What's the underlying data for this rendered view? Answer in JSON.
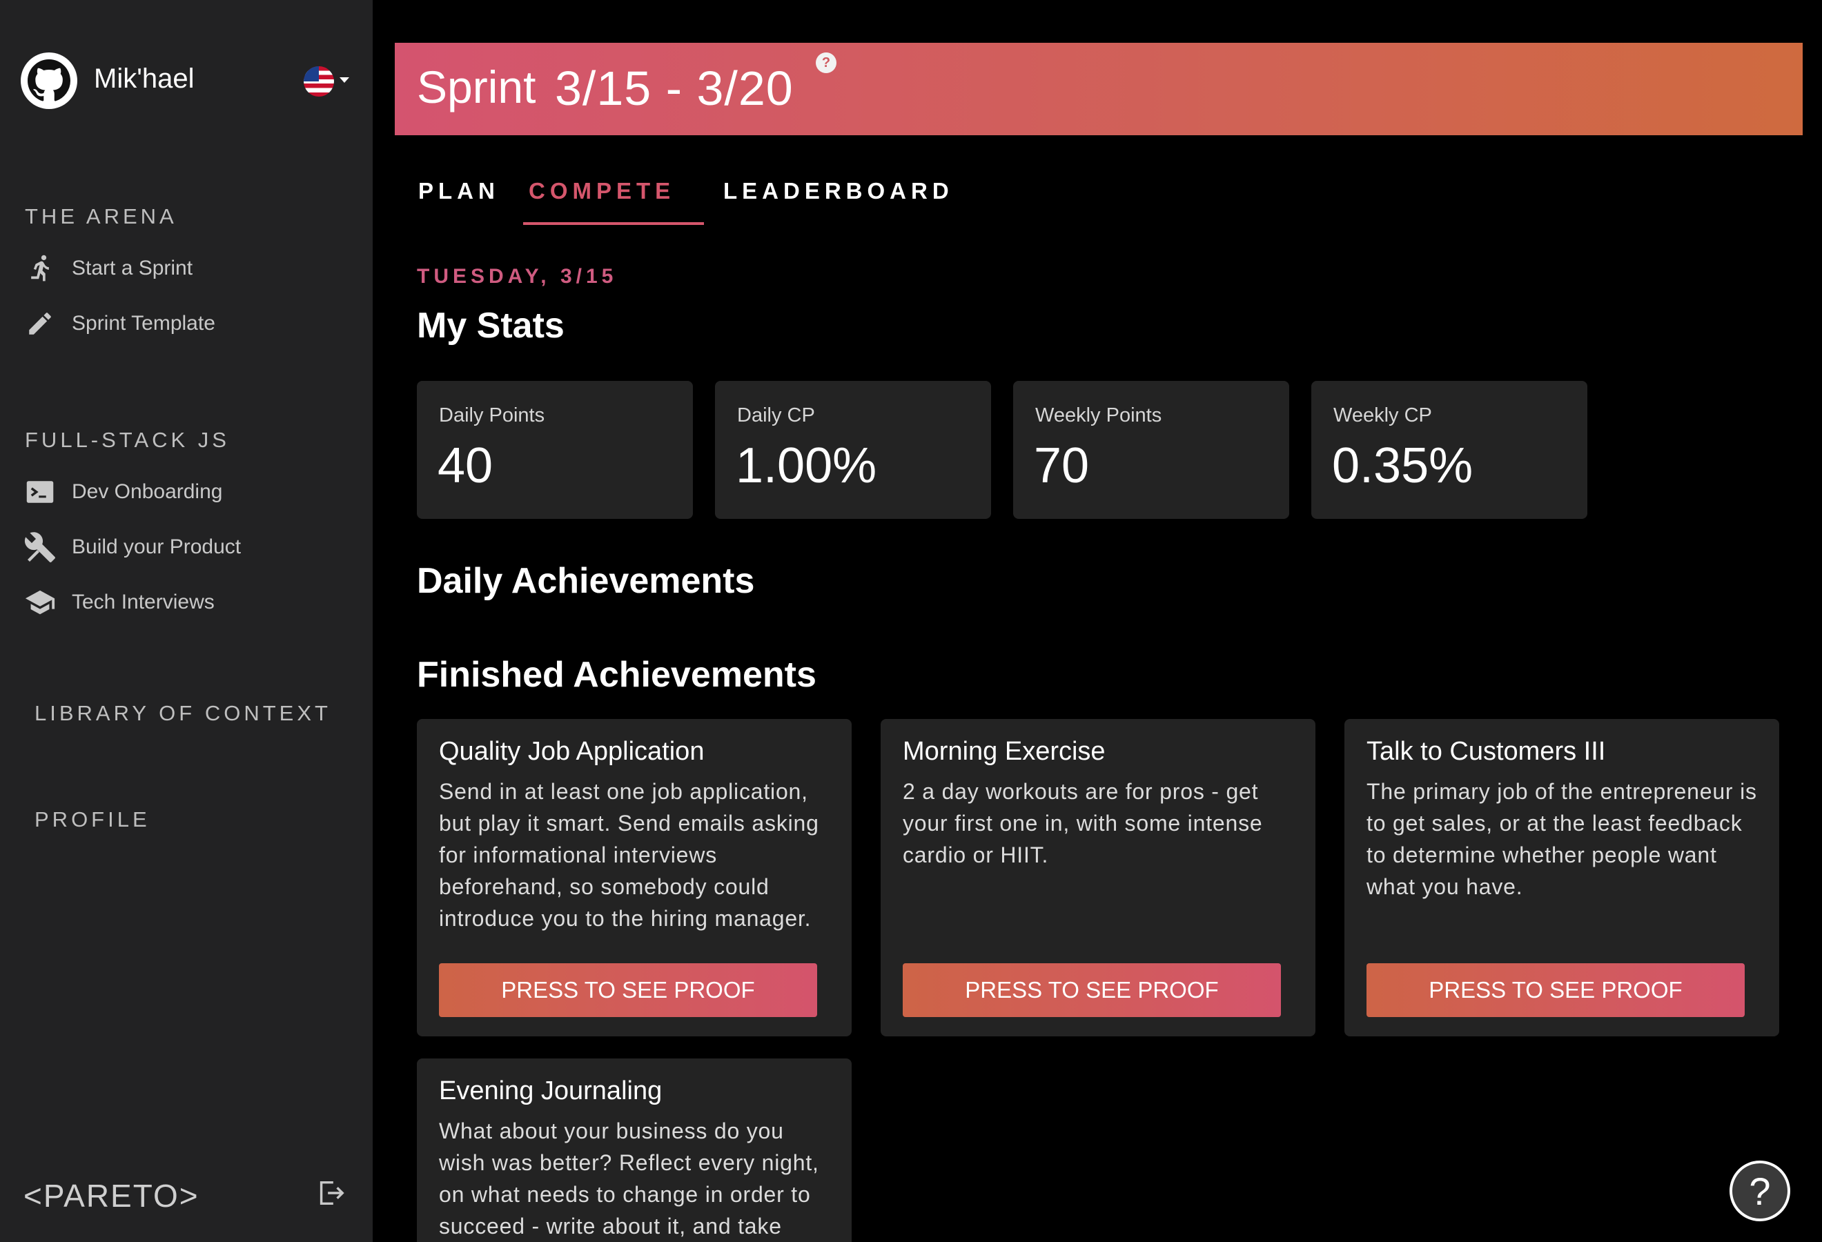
{
  "user": {
    "name": "Mik'hael"
  },
  "sidebar": {
    "sections": [
      {
        "title": "THE ARENA",
        "items": [
          {
            "label": "Start a Sprint",
            "icon": "running-icon"
          },
          {
            "label": "Sprint Template",
            "icon": "pencil-icon"
          }
        ]
      },
      {
        "title": "FULL-STACK JS",
        "items": [
          {
            "label": "Dev Onboarding",
            "icon": "terminal-icon"
          },
          {
            "label": "Build your Product",
            "icon": "tools-icon"
          },
          {
            "label": "Tech Interviews",
            "icon": "graduation-cap-icon"
          }
        ]
      },
      {
        "title": "LIBRARY OF CONTEXT",
        "items": []
      },
      {
        "title": "PROFILE",
        "items": []
      }
    ],
    "logo": "<PARETO>"
  },
  "sprint": {
    "title": "Sprint",
    "dates": "3/15 - 3/20",
    "help": "?"
  },
  "tabs": [
    {
      "label": "PLAN",
      "active": false
    },
    {
      "label": "COMPETE",
      "active": true
    },
    {
      "label": "LEADERBOARD",
      "active": false
    }
  ],
  "day_label": "TUESDAY, 3/15",
  "my_stats": {
    "title": "My Stats",
    "cards": [
      {
        "label": "Daily Points",
        "value": "40"
      },
      {
        "label": "Daily CP",
        "value": "1.00%"
      },
      {
        "label": "Weekly Points",
        "value": "70"
      },
      {
        "label": "Weekly CP",
        "value": "0.35%"
      }
    ]
  },
  "daily_achievements": {
    "title": "Daily Achievements"
  },
  "finished_achievements": {
    "title": "Finished Achievements",
    "button_label": "PRESS TO SEE PROOF",
    "items": [
      {
        "title": "Quality Job Application",
        "description": "Send in at least one job application, but play it smart. Send emails asking for informational interviews beforehand, so somebody could introduce you to the hiring manager."
      },
      {
        "title": "Morning Exercise",
        "description": "2 a day workouts are for pros - get your first one in, with some intense cardio or HIIT."
      },
      {
        "title": "Talk to Customers III",
        "description": "The primary job of the entrepreneur is to get sales, or at the least feedback to determine whether people want what you have."
      },
      {
        "title": "Evening Journaling",
        "description": "What about your business do you wish was better? Reflect every night, on what needs to change in order to succeed - write about it, and take"
      }
    ]
  },
  "help_fab": "?",
  "colors": {
    "accent": "#d5566c",
    "accent_orange": "#cf6a3f",
    "card_bg": "#232323",
    "sidebar_bg": "#222223"
  }
}
